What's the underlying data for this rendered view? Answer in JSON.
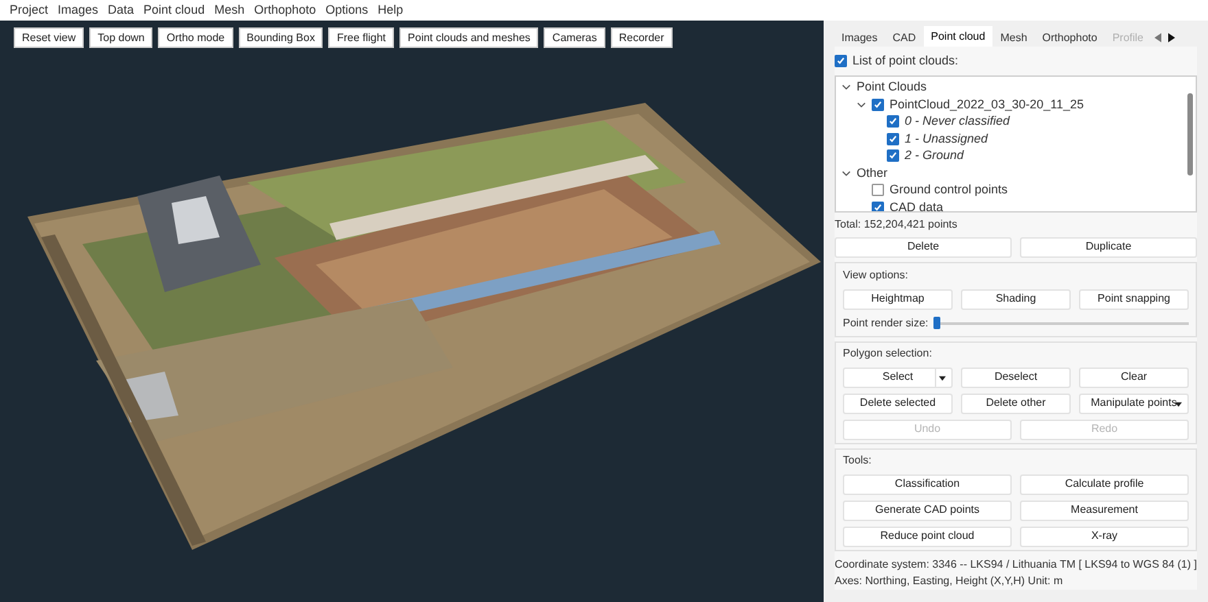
{
  "menu": [
    "Project",
    "Images",
    "Data",
    "Point cloud",
    "Mesh",
    "Orthophoto",
    "Options",
    "Help"
  ],
  "toolbar": [
    "Reset view",
    "Top down",
    "Ortho mode",
    "Bounding Box",
    "Free flight",
    "Point clouds and meshes",
    "Cameras",
    "Recorder"
  ],
  "tabs": [
    {
      "label": "Images",
      "selected": false
    },
    {
      "label": "CAD",
      "selected": false
    },
    {
      "label": "Point cloud",
      "selected": true
    },
    {
      "label": "Mesh",
      "selected": false
    },
    {
      "label": "Orthophoto",
      "selected": false
    },
    {
      "label": "Profile",
      "selected": false,
      "disabled": true
    }
  ],
  "point_cloud_list": {
    "label": "List of point clouds:",
    "checked": true
  },
  "tree": [
    {
      "kind": "group",
      "label": "Point Clouds",
      "expanded": true,
      "children": [
        {
          "kind": "item",
          "label": "PointCloud_2022_03_30-20_11_25",
          "checked": true,
          "expanded": true,
          "children": [
            {
              "kind": "class",
              "label": "0 - Never classified",
              "checked": true
            },
            {
              "kind": "class",
              "label": "1 - Unassigned",
              "checked": true
            },
            {
              "kind": "class",
              "label": "2 - Ground",
              "checked": true
            }
          ]
        }
      ]
    },
    {
      "kind": "group",
      "label": "Other",
      "expanded": true,
      "children": [
        {
          "kind": "item",
          "label": "Ground control points",
          "checked": false
        },
        {
          "kind": "item",
          "label": "CAD data",
          "checked": true
        }
      ]
    }
  ],
  "total": "Total: 152,204,421 points",
  "list_buttons": [
    "Delete",
    "Duplicate"
  ],
  "view_options": {
    "title": "View options:",
    "buttons": [
      "Heightmap",
      "Shading",
      "Point snapping"
    ],
    "slider": {
      "label": "Point render size:",
      "level": 0.0
    }
  },
  "polygon_selection": {
    "title": "Polygon selection:",
    "rows": [
      [
        {
          "label": "Select",
          "kind": "split",
          "disabled": false
        },
        {
          "label": "Deselect",
          "kind": "button",
          "disabled": false
        },
        {
          "label": "Clear",
          "kind": "button",
          "disabled": false
        }
      ],
      [
        {
          "label": "Delete selected",
          "kind": "button",
          "disabled": false
        },
        {
          "label": "Delete other",
          "kind": "button",
          "disabled": false
        },
        {
          "label": "Manipulate points",
          "kind": "dropdown",
          "disabled": false
        }
      ],
      [
        {
          "label": "Undo",
          "kind": "button",
          "disabled": true
        },
        {
          "label": "Redo",
          "kind": "button",
          "disabled": true
        }
      ]
    ]
  },
  "tools": {
    "title": "Tools:",
    "buttons": [
      "Classification",
      "Calculate profile",
      "Generate CAD points",
      "Measurement",
      "Reduce point cloud",
      "X-ray"
    ]
  },
  "status": [
    "Coordinate system: 3346 -- LKS94 / Lithuania TM [ LKS94 to WGS 84 (1) ]",
    "Axes: Northing, Easting, Height (X,Y,H) Unit: m"
  ]
}
